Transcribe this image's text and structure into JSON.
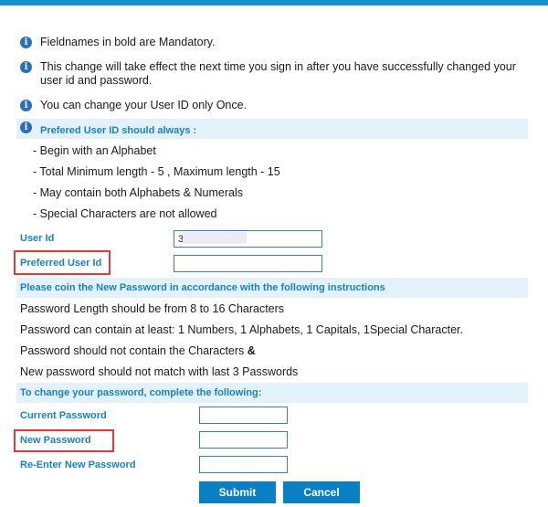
{
  "info": [
    "Fieldnames in bold are Mandatory.",
    "This change will take effect the next time you sign in after you have successfully changed your user id and password.",
    "You can change your User ID only Once."
  ],
  "userid_rules": {
    "heading": "Prefered User ID should always :",
    "items": [
      "- Begin with an Alphabet",
      "- Total Minimum length - 5 , Maximum length - 15",
      "- May contain both Alphabets & Numerals",
      "- Special Characters are not allowed"
    ]
  },
  "userid_form": {
    "user_id_label": "User Id",
    "user_id_value": "3",
    "preferred_label": "Preferred User Id",
    "preferred_value": ""
  },
  "password_rules": {
    "heading": "Please coin the New Password in accordance with the following instructions",
    "line1": "Password Length should be from 8 to 16 Characters",
    "line2": "Password can contain at least:  1 Numbers, 1 Alphabets, 1 Capitals, 1Special Character.",
    "line3_prefix": "Password should not contain the Characters ",
    "line3_chars": "&",
    "line4": "New password should not match with last 3 Passwords"
  },
  "password_form": {
    "heading": "To change your password, complete the following:",
    "current_label": "Current Password",
    "new_label": "New Password",
    "reenter_label": "Re-Enter New Password"
  },
  "buttons": {
    "submit": "Submit",
    "cancel": "Cancel"
  },
  "colors": {
    "accent": "#1a82c2",
    "button": "#0a7fc4",
    "band": "#e3f1fa",
    "highlight": "#e03a3a"
  },
  "icons": {
    "info": "info-icon"
  }
}
